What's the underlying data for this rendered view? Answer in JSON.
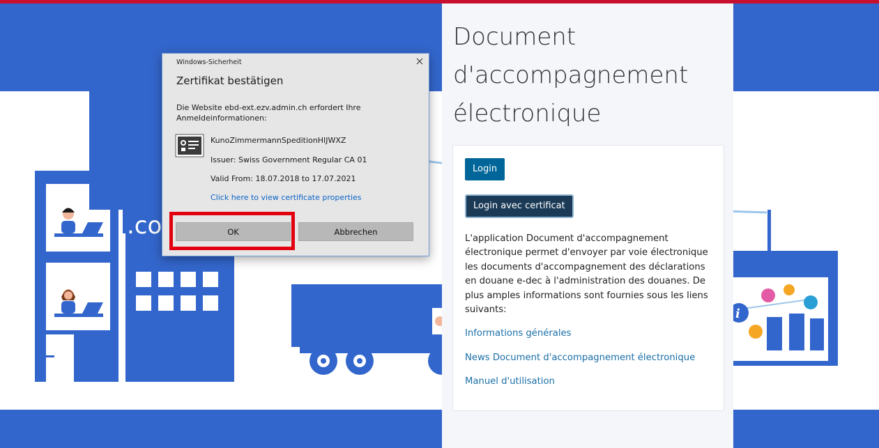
{
  "page": {
    "title": "Document d'accompagnement électronique",
    "login_label": "Login",
    "login_cert_label": "Login avec certificat",
    "description": "L'application Document d'accompagnement électronique permet d'envoyer par voie électronique les documents d'accompagnement des déclarations en douane e-dec à l'administration des douanes. De plus amples informations sont fournies sous les liens suivants:",
    "links": [
      "Informations générales",
      "News Document d'accompagnement électronique",
      "Manuel d'utilisation"
    ]
  },
  "illustration": {
    "building_text": ".co"
  },
  "dialog": {
    "caption": "Windows-Sicherheit",
    "heading": "Zertifikat bestätigen",
    "message": "Die Website ebd-ext.ezv.admin.ch erfordert Ihre Anmeldeinformationen:",
    "certificate": {
      "name": "KunoZimmermannSpeditionHIJWXZ",
      "issuer": "Issuer: Swiss Government Regular CA 01",
      "valid": "Valid From: 18.07.2018 to 17.07.2021",
      "properties_link": "Click here to view certificate properties"
    },
    "ok_label": "OK",
    "cancel_label": "Abbrechen"
  },
  "colors": {
    "accent_red": "#c8102e",
    "illustration_blue": "#3366cc",
    "button_blue": "#006699",
    "button_dark": "#1a3a56",
    "link_blue": "#1b6fa8",
    "highlight_red": "#e3000f"
  }
}
